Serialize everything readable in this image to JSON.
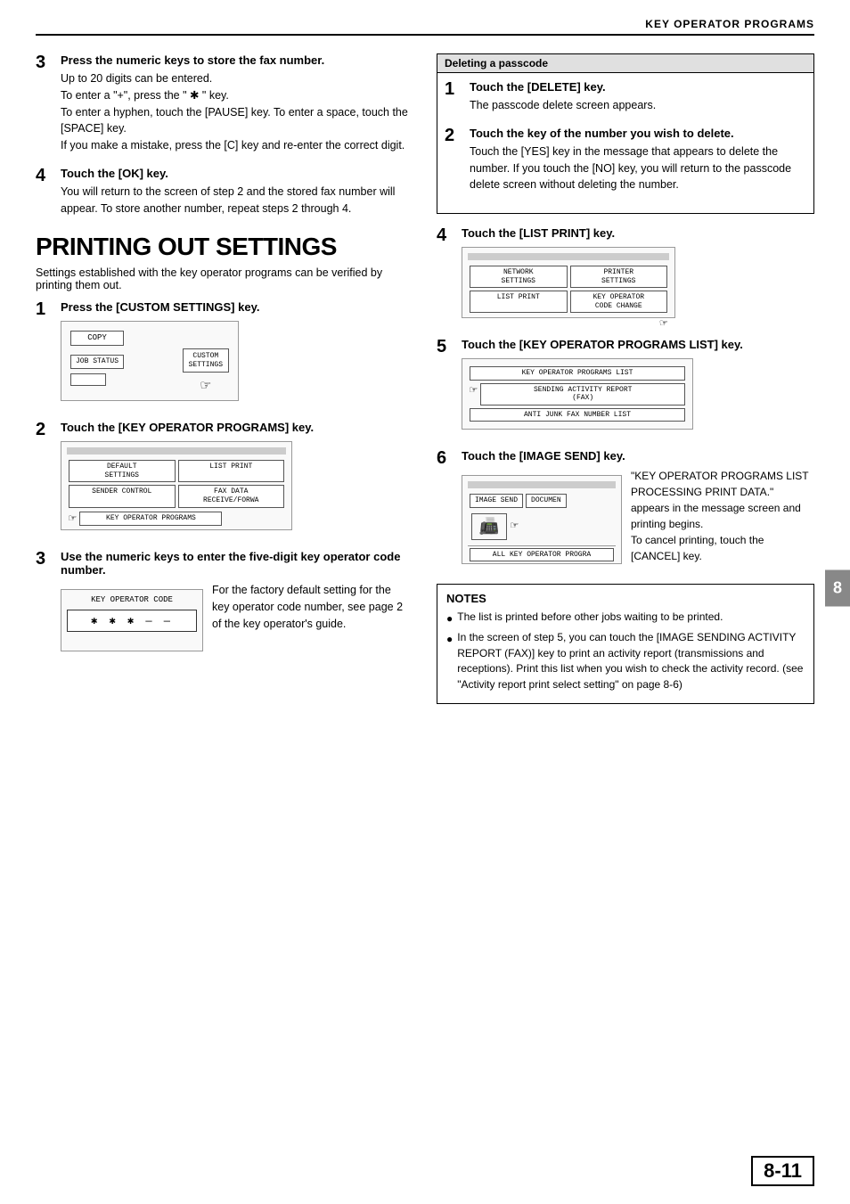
{
  "header": {
    "title": "KEY OPERATOR PROGRAMS"
  },
  "left_col": {
    "step3": {
      "number": "3",
      "title": "Press the numeric keys to store the fax number.",
      "body_lines": [
        "Up to 20 digits can be entered.",
        "To enter a \"+\", press the \" ✱ \" key.",
        "To enter a hyphen, touch the [PAUSE] key. To enter a space, touch the [SPACE] key.",
        "If you make a mistake, press the [C] key and re-enter the correct digit."
      ]
    },
    "step4": {
      "number": "4",
      "title": "Touch the [OK] key.",
      "body": "You will return to the screen of step 2 and the stored fax number will appear. To store another number, repeat steps 2 through 4."
    },
    "section_title": "PRINTING OUT SETTINGS",
    "section_desc": "Settings established with the key operator programs can be verified by printing them out.",
    "ps_step1": {
      "number": "1",
      "title": "Press the [CUSTOM SETTINGS] key."
    },
    "ps_step2": {
      "number": "2",
      "title": "Touch the [KEY OPERATOR PROGRAMS] key."
    },
    "ps_step3": {
      "number": "3",
      "title": "Use the numeric keys to enter the five-digit key operator code number.",
      "body": "For the factory default setting for the key operator code number, see page 2 of the key operator's guide."
    }
  },
  "right_col": {
    "passcode_box_title": "Deleting a passcode",
    "dp_step1": {
      "number": "1",
      "title": "Touch the [DELETE] key.",
      "body": "The passcode delete screen appears."
    },
    "dp_step2": {
      "number": "2",
      "title": "Touch the key of the number you wish to delete.",
      "body": "Touch the [YES] key in the message that appears to delete the number. If you touch the [NO] key, you will return to the passcode delete screen without deleting the number."
    },
    "ps_step4": {
      "number": "4",
      "title": "Touch the [LIST PRINT] key."
    },
    "ps_step5": {
      "number": "5",
      "title": "Touch the [KEY OPERATOR PROGRAMS LIST] key."
    },
    "ps_step6": {
      "number": "6",
      "title": "Touch the [IMAGE SEND] key.",
      "body": "\"KEY OPERATOR PROGRAMS LIST PROCESSING PRINT DATA.\" appears in the message screen and printing begins.\nTo cancel printing, touch the [CANCEL] key."
    }
  },
  "notes": {
    "title": "NOTES",
    "items": [
      "The list is printed before other jobs waiting to be printed.",
      "In the screen of step 5, you can touch the [IMAGE SENDING ACTIVITY REPORT (FAX)] key to print an activity report (transmissions and receptions). Print this list when you wish to check the activity record. (see \"Activity report print select setting\" on page 8-6)"
    ]
  },
  "diagrams": {
    "copy_label": "COPY",
    "job_status": "JOB STATUS",
    "custom_settings": "CUSTOM\nSETTINGS",
    "default_settings": "DEFAULT\nSETTINGS",
    "list_print_small": "LIST PRINT",
    "sender_control": "SENDER CONTROL",
    "fax_data": "FAX DATA\nRECEIVE/FORWA",
    "key_operator_programs": "KEY OPERATOR PROGRAMS",
    "key_operator_code_label": "KEY OPERATOR CODE",
    "key_operator_code_value": "✱ ✱ ✱ — —",
    "network_settings": "NETWORK\nSETTINGS",
    "printer_settings": "PRINTER\nSETTINGS",
    "list_print_big": "LIST PRINT",
    "key_operator_code_change": "KEY OPERATOR\nCODE CHANGE",
    "kop_list": "KEY OPERATOR PROGRAMS LIST",
    "sending_activity": "SENDING ACTIVITY REPORT\n(FAX)",
    "anti_junk": "ANTI JUNK FAX NUMBER LIST",
    "image_send": "IMAGE SEND",
    "document": "DOCUMEN",
    "all_kop": "ALL KEY OPERATOR PROGRA"
  },
  "page_number": "8-11",
  "section_number": "8"
}
